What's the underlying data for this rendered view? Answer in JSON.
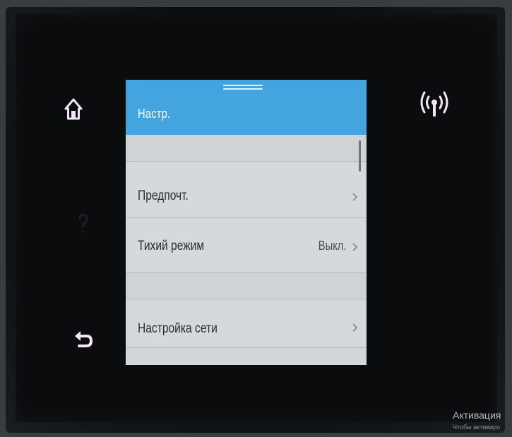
{
  "screen": {
    "title": "Настр.",
    "items": [
      {
        "label": "",
        "value": "",
        "chevron": false
      },
      {
        "label": "Предпочт.",
        "value": "",
        "chevron": true
      },
      {
        "label": "Тихий режим",
        "value": "Выкл.",
        "chevron": true
      },
      {
        "label": "",
        "value": "",
        "chevron": false
      },
      {
        "label": "Настройка сети",
        "value": "",
        "chevron": true
      }
    ]
  },
  "side_buttons": {
    "home": "home-icon",
    "back": "back-arrow-icon",
    "help": "help-icon",
    "wireless": "wireless-icon"
  },
  "colors": {
    "header": "#43a4e0",
    "list_background": "#d4d7d9",
    "icon_tint": "#f4e6f8"
  },
  "watermark": {
    "line1": "Активация",
    "line2": "Чтобы активиро"
  }
}
